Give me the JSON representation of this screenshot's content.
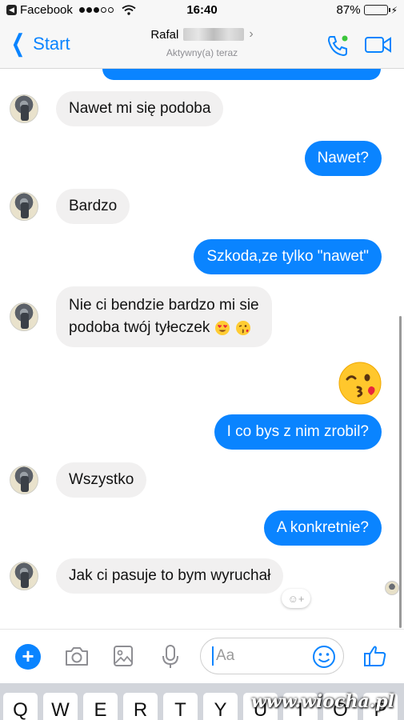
{
  "status_bar": {
    "carrier": "Facebook",
    "time": "16:40",
    "battery": "87%",
    "battery_level": 0.87
  },
  "header": {
    "back_label": "Start",
    "contact_name": "Rafal",
    "contact_status": "Aktywny(a) teraz",
    "icons": [
      "back-chevron-icon",
      "phone-call-icon",
      "video-camera-icon"
    ]
  },
  "messages": [
    {
      "from": "contact",
      "text": "Nawet mi się podoba"
    },
    {
      "from": "me",
      "text": "Nawet?"
    },
    {
      "from": "contact",
      "text": "Bardzo"
    },
    {
      "from": "me",
      "text": "Szkoda,ze tylko \"nawet\""
    },
    {
      "from": "contact",
      "lines": [
        "Nie ci bendzie bardzo mi sie",
        "podoba twój tyłeczek"
      ],
      "emojis": [
        "heart-eyes-emoji",
        "kissing-heart-emoji"
      ]
    },
    {
      "from": "me",
      "sticker": "kissing-heart-emoji"
    },
    {
      "from": "me",
      "text": "I co bys z nim zrobil?"
    },
    {
      "from": "contact",
      "text": "Wszystko"
    },
    {
      "from": "me",
      "text": "A konkretnie?"
    },
    {
      "from": "contact",
      "text": "Jak ci pasuje to bym wyruchał"
    }
  ],
  "composer": {
    "placeholder": "Aa",
    "icons": [
      "plus-icon",
      "camera-icon",
      "image-icon",
      "microphone-icon",
      "smiley-icon",
      "thumbs-up-icon"
    ]
  },
  "keyboard": {
    "row1": [
      "Q",
      "W",
      "E",
      "R",
      "T",
      "Y",
      "U",
      "I",
      "O",
      "P"
    ]
  },
  "watermark": "www.wiocha.pl",
  "colors": {
    "accent": "#0a84ff",
    "incoming_bubble": "#f1f0f0",
    "battery": "#f5c400"
  }
}
